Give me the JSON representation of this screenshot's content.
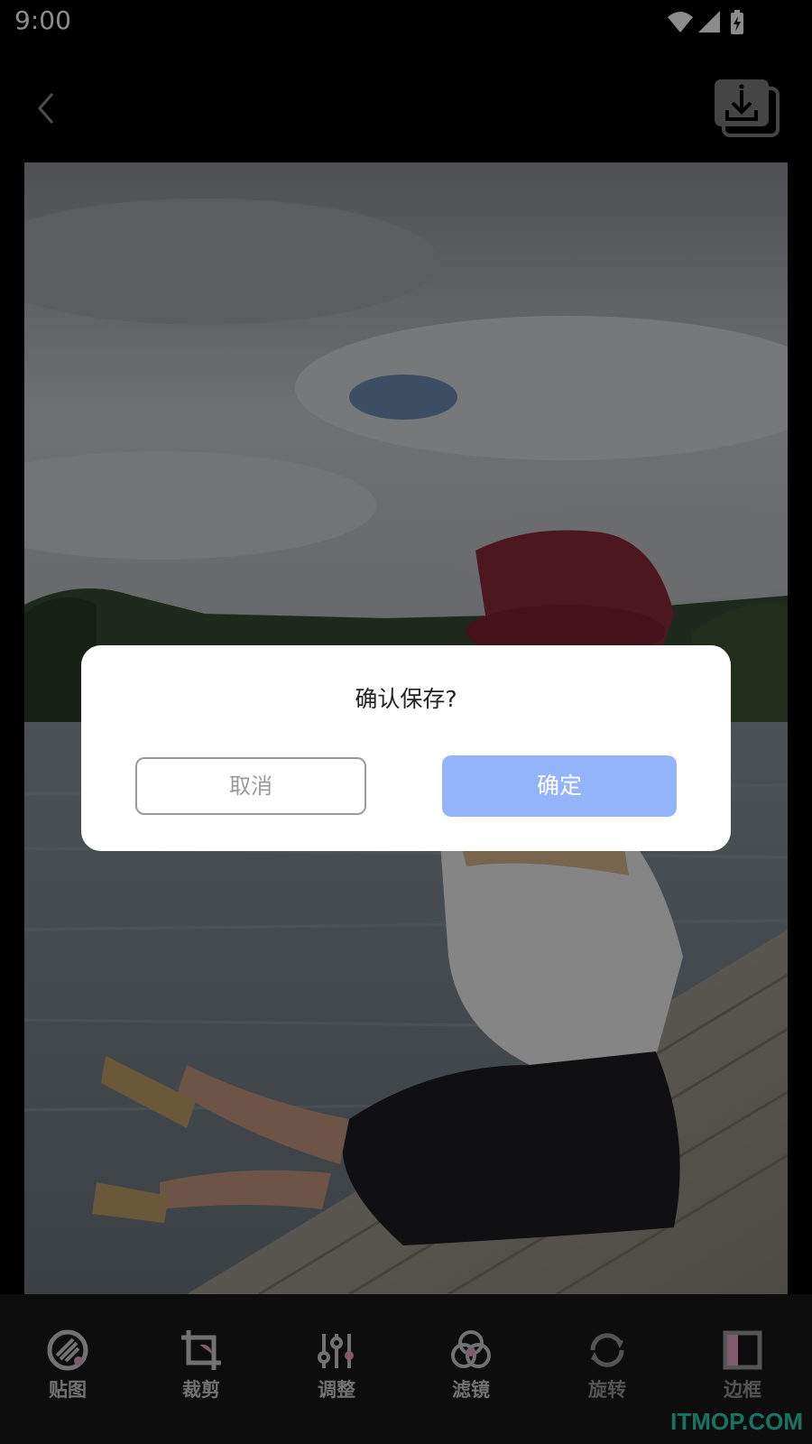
{
  "status_bar": {
    "time": "9:00"
  },
  "dialog": {
    "title": "确认保存?",
    "cancel_label": "取消",
    "confirm_label": "确定"
  },
  "toolbar": {
    "items": [
      {
        "label": "贴图",
        "icon": "sticker-icon"
      },
      {
        "label": "裁剪",
        "icon": "crop-icon"
      },
      {
        "label": "调整",
        "icon": "adjust-icon"
      },
      {
        "label": "滤镜",
        "icon": "filter-icon"
      },
      {
        "label": "旋转",
        "icon": "rotate-icon"
      },
      {
        "label": "边框",
        "icon": "frame-icon"
      }
    ]
  },
  "watermark": "ITMOP.COM",
  "colors": {
    "confirm_button": "#93b3fb",
    "accent_pink": "#e9a6c7",
    "toolbar_bg": "#181818",
    "watermark": "#2bd1b6"
  }
}
